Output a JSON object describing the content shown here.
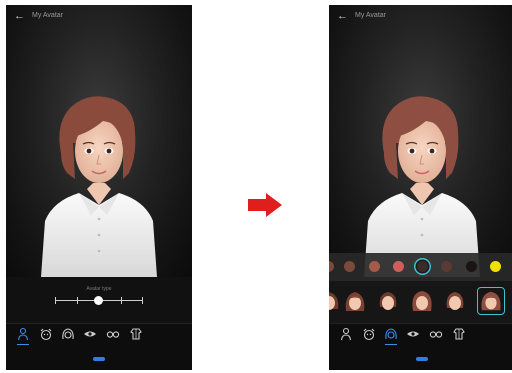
{
  "screen_left": {
    "title": "My Avatar",
    "slider_label": "Avatar type",
    "slider_value": 0.5,
    "tabs": [
      "body-icon",
      "face-icon",
      "hair-icon",
      "eye-icon",
      "glasses-icon",
      "clothing-icon"
    ],
    "active_tab": 0,
    "done_label": ""
  },
  "screen_right": {
    "title": "My Avatar",
    "hair_colors": [
      "#7a4a3a",
      "#a55a4a",
      "#c9605a",
      "#3a2a28",
      "#5a3a32",
      "#1a1412",
      "#f2e000"
    ],
    "selected_color": 3,
    "preset_count": 5,
    "selected_preset": 4,
    "active_tab": 2
  },
  "transition_arrow_color": "#e01e1e",
  "colors": {
    "accent": "#3b8fe8",
    "selection": "#3fc3d0",
    "hair": "#8a4a3c",
    "shirt": "#f0f0f0"
  }
}
